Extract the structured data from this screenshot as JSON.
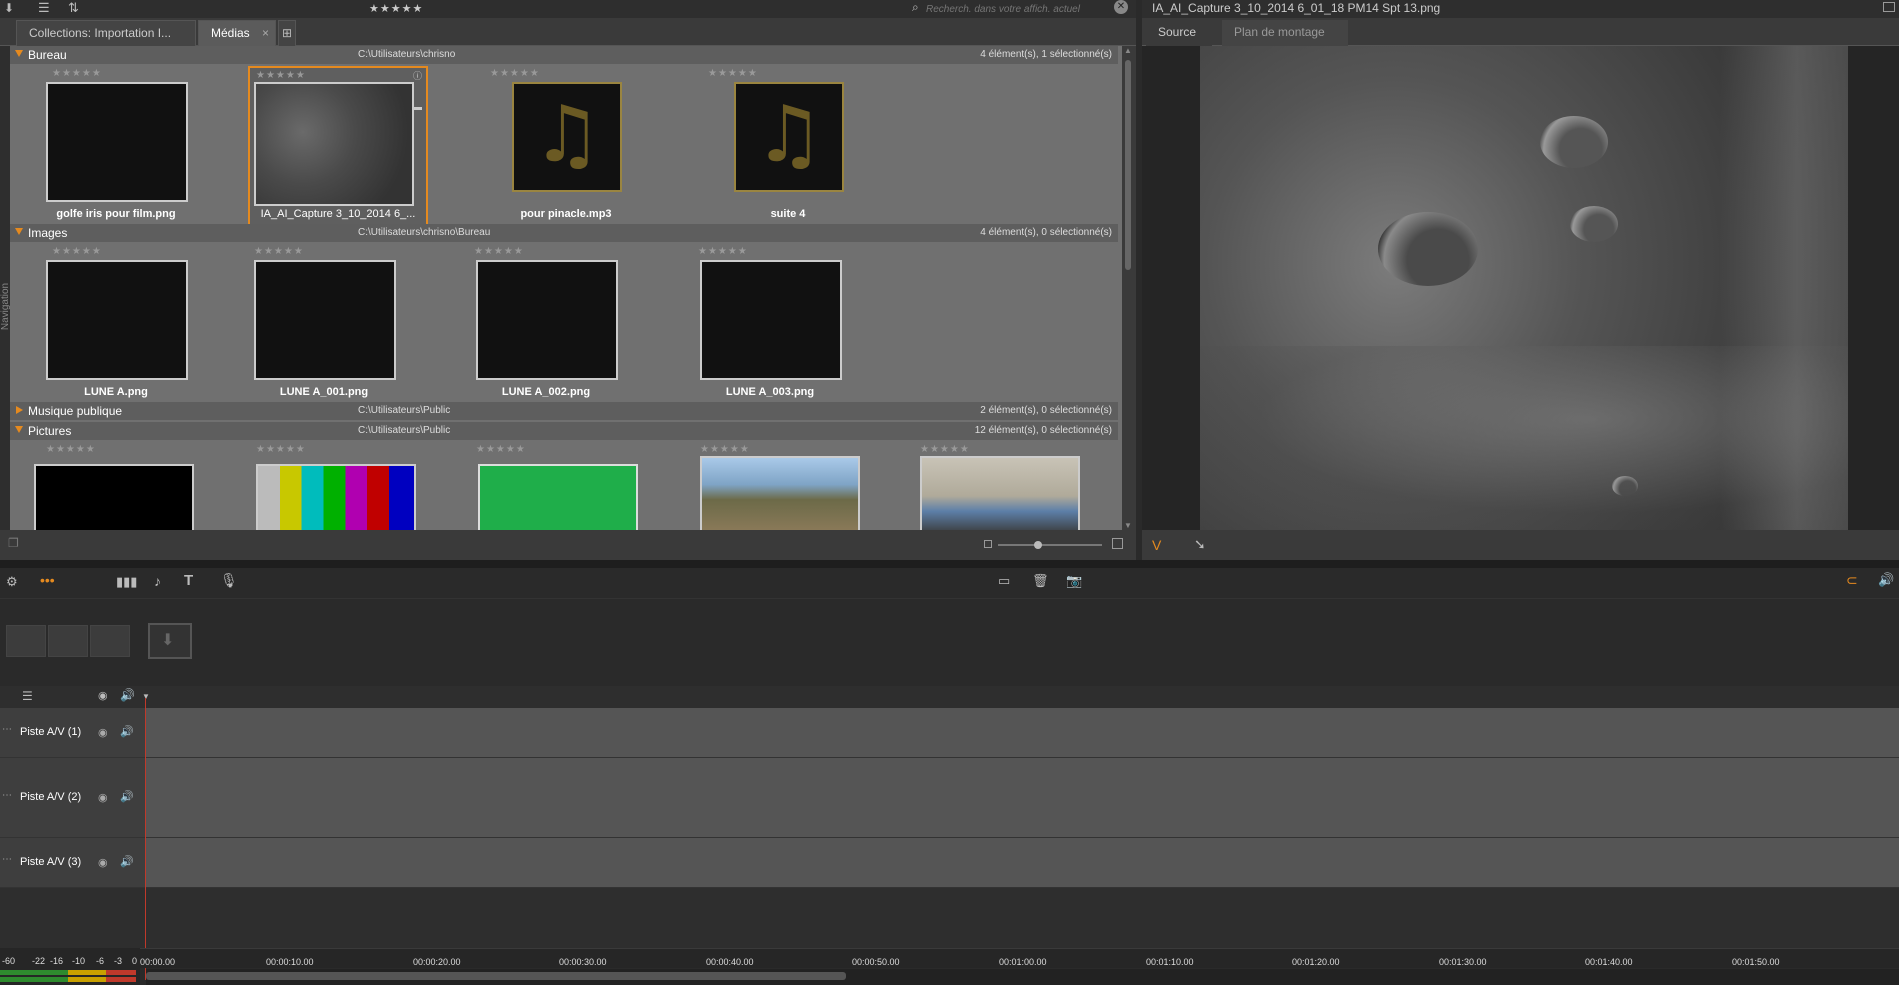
{
  "library": {
    "toolbar": {
      "rating_filter": "★★★★★",
      "search_placeholder": "Recherch. dans votre affich. actuel"
    },
    "tabs": [
      {
        "label": "Collections: Importation I..."
      },
      {
        "label": "Médias"
      }
    ],
    "tab_close": "×",
    "navigation_label": "Navigation",
    "groups": [
      {
        "name": "Bureau",
        "path": "C:\\Utilisateurs\\chrisno",
        "count": "4 élément(s), 1 sélectionné(s)",
        "items": [
          {
            "label": "golfe iris pour film.png",
            "stars": "★★★★★"
          },
          {
            "label": "IA_AI_Capture 3_10_2014 6_...",
            "stars": "★★★★★"
          },
          {
            "label": "pour pinacle.mp3",
            "stars": "★★★★★"
          },
          {
            "label": "suite 4",
            "stars": "★★★★★"
          }
        ]
      },
      {
        "name": "Images",
        "path": "C:\\Utilisateurs\\chrisno\\Bureau",
        "count": "4 élément(s), 0 sélectionné(s)",
        "items": [
          {
            "label": "LUNE A.png",
            "stars": "★★★★★"
          },
          {
            "label": "LUNE A_001.png",
            "stars": "★★★★★"
          },
          {
            "label": "LUNE A_002.png",
            "stars": "★★★★★"
          },
          {
            "label": "LUNE A_003.png",
            "stars": "★★★★★"
          }
        ]
      },
      {
        "name": "Musique publique",
        "path": "C:\\Utilisateurs\\Public",
        "count": "2 élément(s), 0 sélectionné(s)"
      },
      {
        "name": "Pictures",
        "path": "C:\\Utilisateurs\\Public",
        "count": "12 élément(s), 0 sélectionné(s)",
        "items": [
          {
            "stars": "★★★★★"
          },
          {
            "stars": "★★★★★"
          },
          {
            "stars": "★★★★★"
          },
          {
            "stars": "★★★★★"
          },
          {
            "stars": "★★★★★"
          }
        ]
      }
    ]
  },
  "preview": {
    "title": "IA_AI_Capture 3_10_2014 6_01_18 PM14 Spt 13.png",
    "tabs": [
      {
        "label": "Source"
      },
      {
        "label": "Plan de montage"
      }
    ],
    "v_label": "V"
  },
  "timeline": {
    "tracks": [
      {
        "name": "Piste A/V (1)"
      },
      {
        "name": "Piste A/V (2)"
      },
      {
        "name": "Piste A/V (3)"
      }
    ],
    "ruler": [
      "00:00.00",
      "00:00:10.00",
      "00:00:20.00",
      "00:00:30.00",
      "00:00:40.00",
      "00:00:50.00",
      "00:01:00.00",
      "00:01:10.00",
      "00:01:20.00",
      "00:01:30.00",
      "00:01:40.00",
      "00:01:50.00"
    ],
    "vu_labels": [
      "-60",
      "-22",
      "-16",
      "-10",
      "-6",
      "-3",
      "0"
    ]
  }
}
